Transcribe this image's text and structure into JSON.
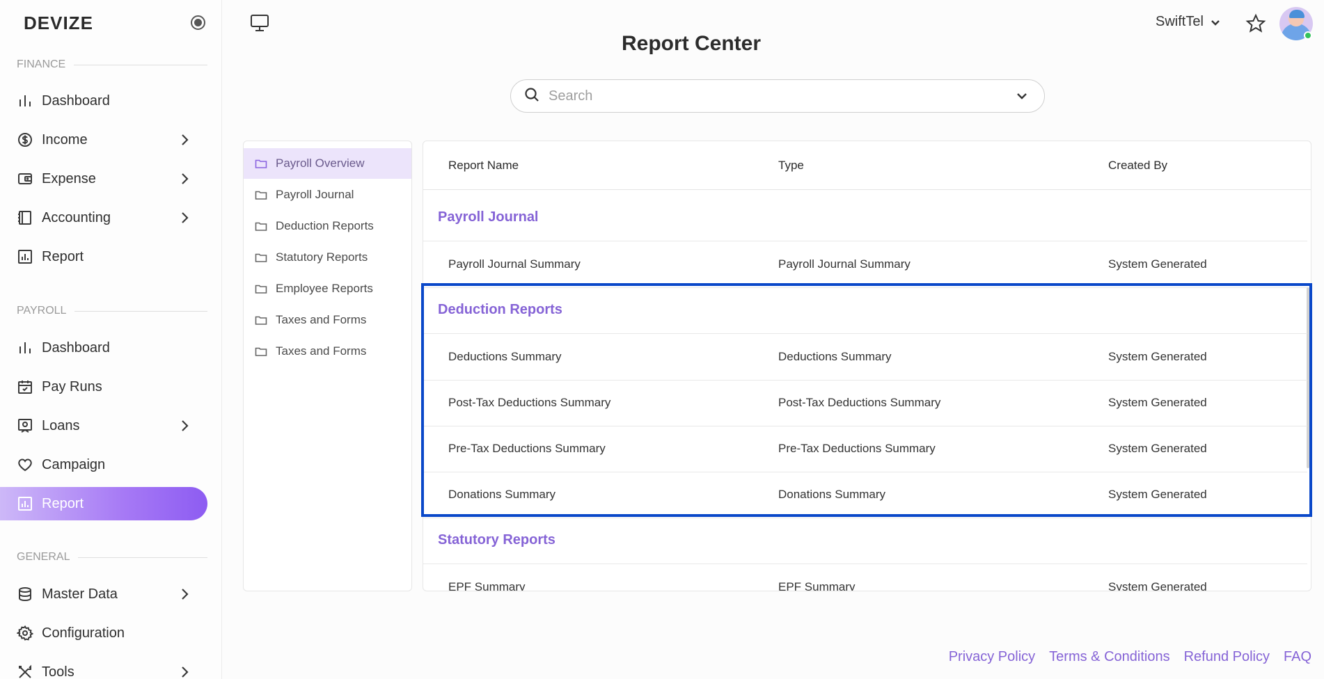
{
  "brand": "DEVIZE",
  "sidebar": {
    "sections": [
      {
        "label": "FINANCE"
      },
      {
        "label": "PAYROLL"
      },
      {
        "label": "GENERAL"
      }
    ],
    "finance_items": [
      {
        "label": "Dashboard",
        "icon": "bar-chart-icon",
        "chevron": false
      },
      {
        "label": "Income",
        "icon": "dollar-circle-icon",
        "chevron": true
      },
      {
        "label": "Expense",
        "icon": "wallet-icon",
        "chevron": true
      },
      {
        "label": "Accounting",
        "icon": "ledger-icon",
        "chevron": true
      },
      {
        "label": "Report",
        "icon": "report-icon",
        "chevron": false
      }
    ],
    "payroll_items": [
      {
        "label": "Dashboard",
        "icon": "bar-chart-icon",
        "chevron": false
      },
      {
        "label": "Pay Runs",
        "icon": "calendar-check-icon",
        "chevron": false
      },
      {
        "label": "Loans",
        "icon": "loan-icon",
        "chevron": true
      },
      {
        "label": "Campaign",
        "icon": "heart-icon",
        "chevron": false
      },
      {
        "label": "Report",
        "icon": "report-icon",
        "chevron": false,
        "active": true
      }
    ],
    "general_items": [
      {
        "label": "Master Data",
        "icon": "database-icon",
        "chevron": true
      },
      {
        "label": "Configuration",
        "icon": "gear-icon",
        "chevron": false
      },
      {
        "label": "Tools",
        "icon": "tools-icon",
        "chevron": true
      }
    ]
  },
  "header": {
    "title": "Report Center",
    "company": "SwiftTel"
  },
  "search": {
    "placeholder": "Search",
    "value": ""
  },
  "categories": [
    {
      "label": "Payroll Overview",
      "active": true
    },
    {
      "label": "Payroll Journal"
    },
    {
      "label": "Deduction Reports"
    },
    {
      "label": "Statutory Reports"
    },
    {
      "label": "Employee Reports"
    },
    {
      "label": "Taxes and Forms"
    },
    {
      "label": "Taxes and Forms"
    }
  ],
  "table": {
    "columns": [
      "Report Name",
      "Type",
      "Created By"
    ],
    "groups": [
      {
        "title": "Payroll Journal",
        "rows": [
          [
            "Payroll Journal Summary",
            "Payroll Journal Summary",
            "System Generated"
          ]
        ]
      },
      {
        "title": "Deduction Reports",
        "rows": [
          [
            "Deductions Summary",
            "Deductions Summary",
            "System Generated"
          ],
          [
            "Post-Tax Deductions Summary",
            "Post-Tax Deductions Summary",
            "System Generated"
          ],
          [
            "Pre-Tax Deductions Summary",
            "Pre-Tax Deductions Summary",
            "System Generated"
          ],
          [
            "Donations Summary",
            "Donations Summary",
            "System Generated"
          ]
        ]
      },
      {
        "title": "Statutory Reports",
        "rows": [
          [
            "EPF Summary",
            "EPF Summary",
            "System Generated"
          ]
        ]
      }
    ]
  },
  "footer": {
    "links": [
      "Privacy Policy",
      "Terms & Conditions",
      "Refund Policy",
      "FAQ"
    ]
  },
  "colors": {
    "accent": "#8563d6",
    "highlight": "#0a48c9",
    "online": "#33c25b"
  }
}
